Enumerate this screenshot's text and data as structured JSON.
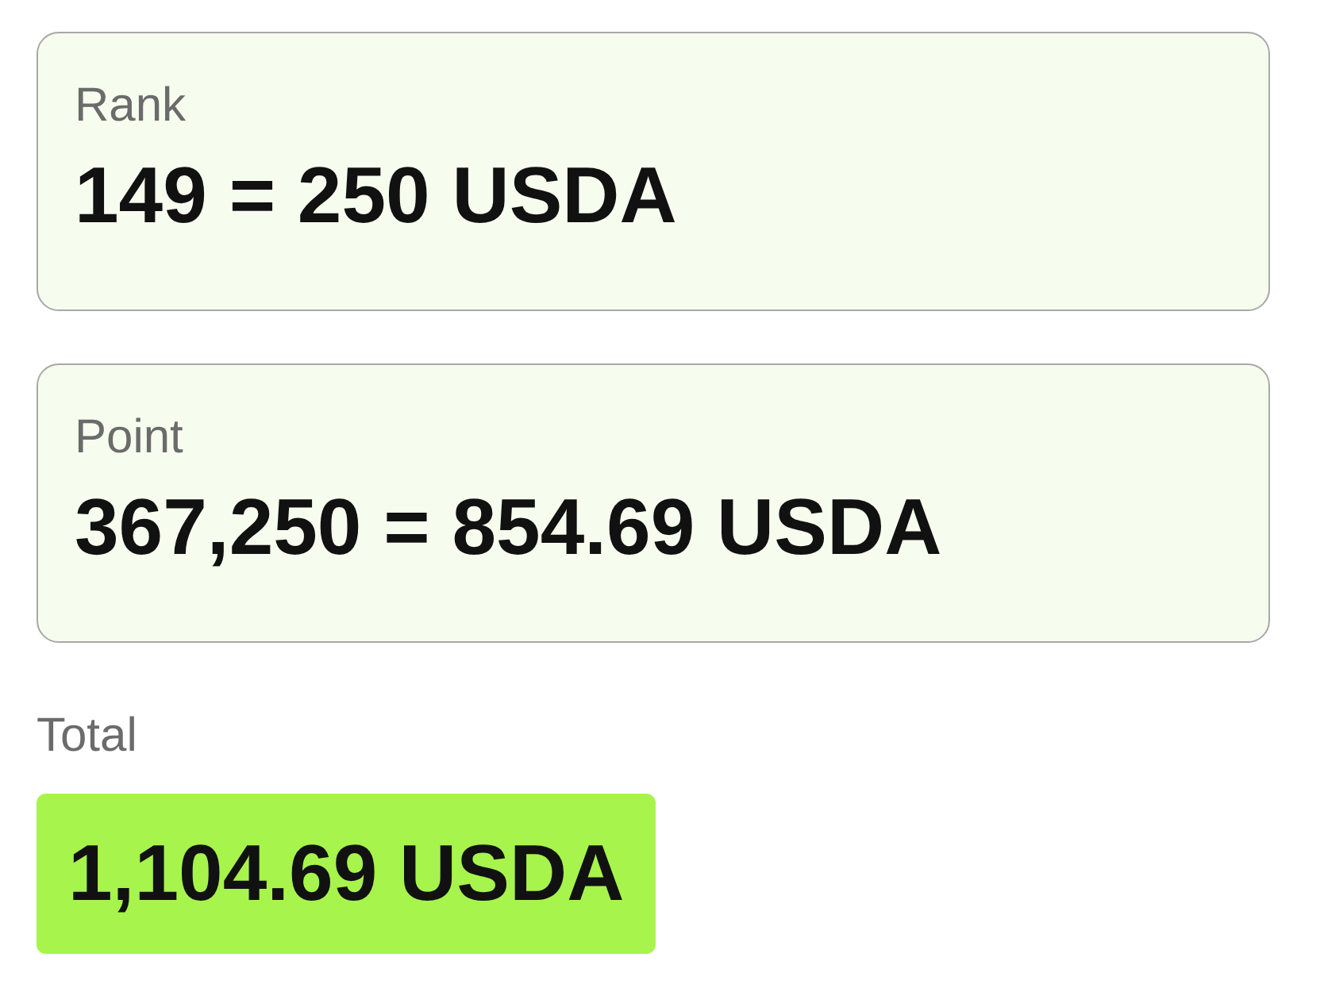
{
  "cards": [
    {
      "label": "Rank",
      "value": "149 = 250 USDA"
    },
    {
      "label": "Point",
      "value": "367,250 = 854.69 USDA"
    }
  ],
  "total": {
    "label": "Total",
    "value": "1,104.69 USDA"
  }
}
